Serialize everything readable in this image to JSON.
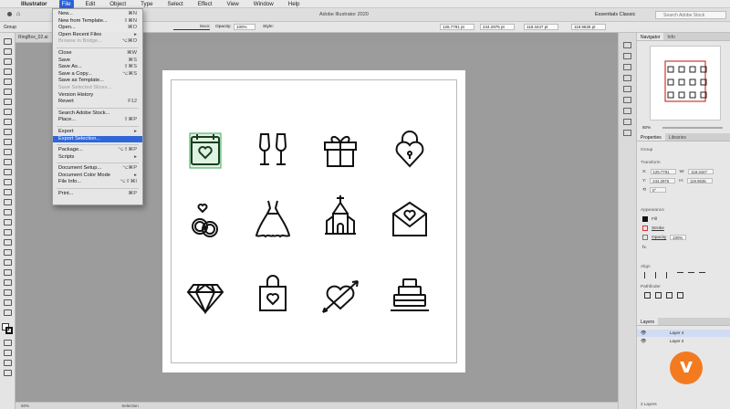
{
  "macbar": {
    "apple": "",
    "app": "Illustrator",
    "menus": [
      "File",
      "Edit",
      "Object",
      "Type",
      "Select",
      "Effect",
      "View",
      "Window",
      "Help"
    ]
  },
  "apptop": {
    "title": "Adobe Illustrator 2020",
    "workspace": "Essentials Classic",
    "search_placeholder": "Search Adobe Stock"
  },
  "ctrlbar": {
    "left": "Group",
    "stroke_style": "Basic",
    "opacity_label": "Opacity:",
    "opacity": "100%",
    "style_label": "Style:",
    "x": "126.7791 pt",
    "y": "244.2975 pt",
    "w": "118.3447 pt",
    "h": "119.9635 pt"
  },
  "doc_tab": "RingBox_02.ai",
  "file_menu": [
    {
      "label": "New...",
      "sc": "⌘N"
    },
    {
      "label": "New from Template...",
      "sc": "⇧⌘N"
    },
    {
      "label": "Open...",
      "sc": "⌘O"
    },
    {
      "label": "Open Recent Files",
      "sc": "▸"
    },
    {
      "label": "Browse in Bridge...",
      "sc": "⌥⌘O",
      "dis": true
    },
    {
      "sep": true
    },
    {
      "label": "Close",
      "sc": "⌘W"
    },
    {
      "label": "Save",
      "sc": "⌘S"
    },
    {
      "label": "Save As...",
      "sc": "⇧⌘S"
    },
    {
      "label": "Save a Copy...",
      "sc": "⌥⌘S"
    },
    {
      "label": "Save as Template...",
      "sc": ""
    },
    {
      "label": "Save Selected Slices...",
      "sc": "",
      "dis": true
    },
    {
      "label": "Version History",
      "sc": ""
    },
    {
      "label": "Revert",
      "sc": "F12"
    },
    {
      "sep": true
    },
    {
      "label": "Search Adobe Stock...",
      "sc": ""
    },
    {
      "label": "Place...",
      "sc": "⇧⌘P"
    },
    {
      "sep": true
    },
    {
      "label": "Export",
      "sc": "▸"
    },
    {
      "label": "Export Selection...",
      "sc": "",
      "hl": true
    },
    {
      "sep": true
    },
    {
      "label": "Package...",
      "sc": "⌥⇧⌘P"
    },
    {
      "label": "Scripts",
      "sc": "▸"
    },
    {
      "sep": true
    },
    {
      "label": "Document Setup...",
      "sc": "⌥⌘P"
    },
    {
      "label": "Document Color Mode",
      "sc": "▸"
    },
    {
      "label": "File Info...",
      "sc": "⌥⇧⌘I"
    },
    {
      "sep": true
    },
    {
      "label": "Print...",
      "sc": "⌘P"
    }
  ],
  "right_panel": {
    "nav_tabs": [
      "Navigator",
      "Info"
    ],
    "zoom": "50%",
    "prop_tabs": [
      "Properties",
      "Libraries"
    ],
    "group_label": "Group",
    "transform": "Transform",
    "x_label": "X:",
    "x": "126.7791",
    "y_label": "Y:",
    "y": "244.2975",
    "w_label": "W:",
    "w": "118.3447",
    "h_label": "H:",
    "h": "119.9635",
    "angle": "0°",
    "appearance": "Appearance",
    "fill": "Fill",
    "stroke": "Stroke",
    "opacity_label": "Opacity",
    "opacity": "100%",
    "fx": "fx.",
    "align": "Align",
    "pathfinder": "Pathfinder",
    "layers_title": "Layers",
    "layers": [
      "Layer 4",
      "Layer 2"
    ],
    "layers_count": "2 Layers"
  },
  "icons": [
    "calendar-heart-icon",
    "champagne-glasses-icon",
    "gift-icon",
    "heart-padlock-icon",
    "rings-icon",
    "wedding-dress-icon",
    "chapel-icon",
    "love-letter-icon",
    "diamond-icon",
    "shopping-bag-heart-icon",
    "heart-arrow-icon",
    "wedding-cake-icon"
  ],
  "status": {
    "zoom": "50%",
    "tool": "Selection"
  },
  "colors": {
    "accent": "#2f66d9",
    "selection": "#3aa655",
    "vimeo": "#f47a20"
  }
}
